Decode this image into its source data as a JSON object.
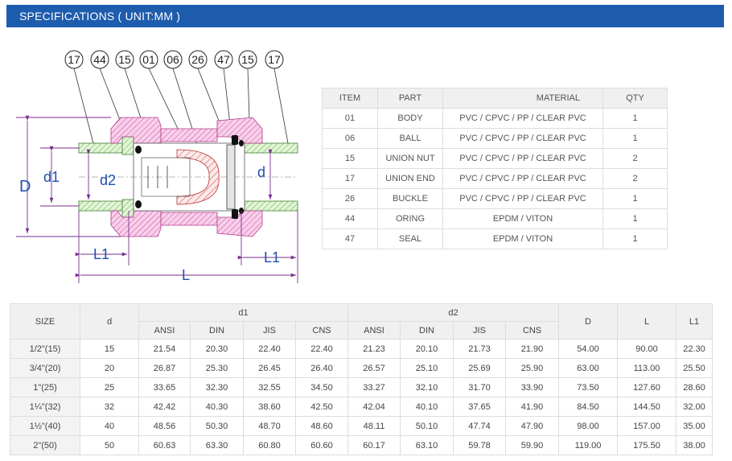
{
  "header": {
    "title": "SPECIFICATIONS ( UNIT:MM )"
  },
  "drawing": {
    "callouts": [
      "17",
      "44",
      "15",
      "01",
      "06",
      "26",
      "47",
      "15",
      "17"
    ],
    "dim_labels": {
      "D": "D",
      "d1": "d1",
      "d2": "d2",
      "d": "d",
      "L1_left": "L1",
      "L1_right": "L1",
      "L": "L"
    }
  },
  "parts_table": {
    "headers": [
      "ITEM",
      "PART",
      "MATERIAL",
      "QTY"
    ],
    "rows": [
      [
        "01",
        "BODY",
        "PVC / CPVC / PP / CLEAR PVC",
        "1"
      ],
      [
        "06",
        "BALL",
        "PVC / CPVC / PP / CLEAR PVC",
        "1"
      ],
      [
        "15",
        "UNION NUT",
        "PVC / CPVC / PP / CLEAR PVC",
        "2"
      ],
      [
        "17",
        "UNION END",
        "PVC / CPVC / PP / CLEAR PVC",
        "2"
      ],
      [
        "26",
        "BUCKLE",
        "PVC / CPVC / PP / CLEAR PVC",
        "1"
      ],
      [
        "44",
        "ORING",
        "EPDM / VITON",
        "1"
      ],
      [
        "47",
        "SEAL",
        "EPDM / VITON",
        "1"
      ]
    ]
  },
  "spec_table": {
    "headers": {
      "size": "SIZE",
      "d": "d",
      "d1": "d1",
      "d2": "d2",
      "D": "D",
      "L": "L",
      "L1": "L1",
      "sub": [
        "ANSI",
        "DIN",
        "JIS",
        "CNS",
        "ANSI",
        "DIN",
        "JIS",
        "CNS"
      ]
    },
    "rows": [
      [
        "1/2\"(15)",
        "15",
        "21.54",
        "20.30",
        "22.40",
        "22.40",
        "21.23",
        "20.10",
        "21.73",
        "21.90",
        "54.00",
        "90.00",
        "22.30"
      ],
      [
        "3/4\"(20)",
        "20",
        "26.87",
        "25.30",
        "26.45",
        "26.40",
        "26.57",
        "25.10",
        "25.69",
        "25.90",
        "63.00",
        "113.00",
        "25.50"
      ],
      [
        "1\"(25)",
        "25",
        "33.65",
        "32.30",
        "32.55",
        "34.50",
        "33.27",
        "32.10",
        "31.70",
        "33.90",
        "73.50",
        "127.60",
        "28.60"
      ],
      [
        "1¼\"(32)",
        "32",
        "42.42",
        "40.30",
        "38.60",
        "42.50",
        "42.04",
        "40.10",
        "37.65",
        "41.90",
        "84.50",
        "144.50",
        "32.00"
      ],
      [
        "1½\"(40)",
        "40",
        "48.56",
        "50.30",
        "48.70",
        "48.60",
        "48.11",
        "50.10",
        "47.74",
        "47.90",
        "98.00",
        "157.00",
        "35.00"
      ],
      [
        "2\"(50)",
        "50",
        "60.63",
        "63.30",
        "60.80",
        "60.60",
        "60.17",
        "63.10",
        "59.78",
        "59.90",
        "119.00",
        "175.50",
        "38.00"
      ]
    ]
  }
}
